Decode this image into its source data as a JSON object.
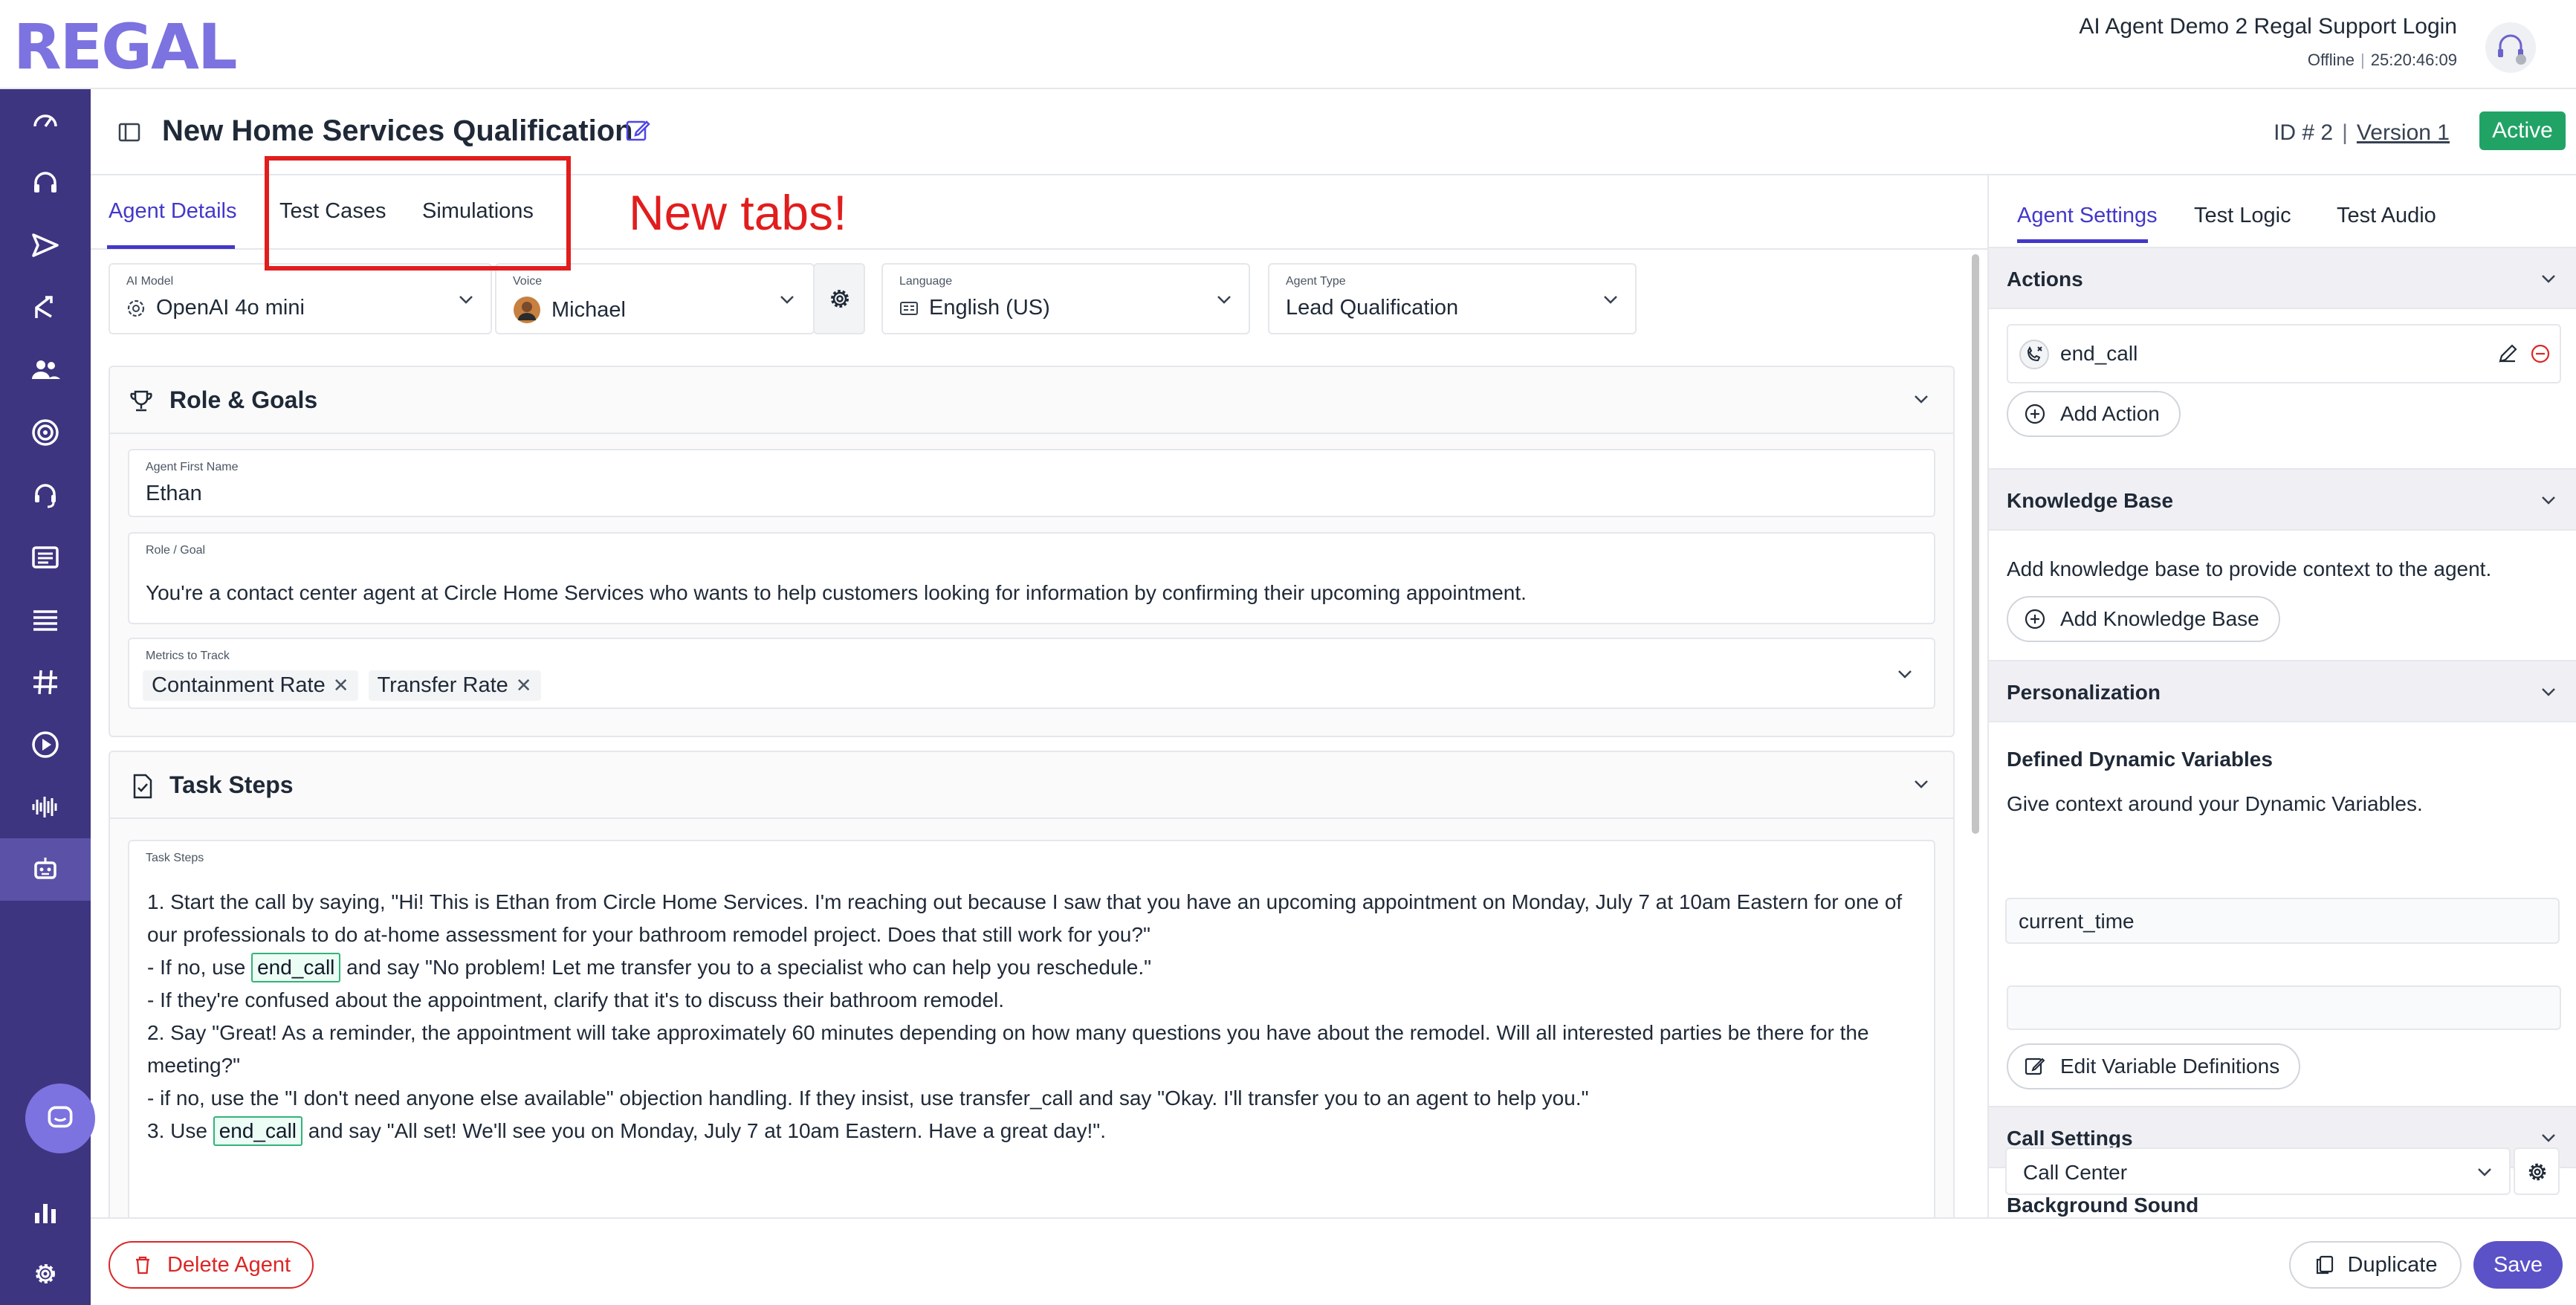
{
  "brand": {
    "logo": "REGAL",
    "accent_color": "#3d3580",
    "active_color": "#21a366"
  },
  "user": {
    "name": "AI Agent Demo 2 Regal Support Login",
    "status": "Offline",
    "timer": "25:20:46:09"
  },
  "sidebar": {
    "items": [
      {
        "icon": "speedometer-icon"
      },
      {
        "icon": "headset-icon"
      },
      {
        "icon": "send-icon"
      },
      {
        "icon": "branch-icon"
      },
      {
        "icon": "users-icon"
      },
      {
        "icon": "target-icon"
      },
      {
        "icon": "support-agent-icon"
      },
      {
        "icon": "contact-card-icon"
      },
      {
        "icon": "list-icon"
      },
      {
        "icon": "hashtag-icon"
      },
      {
        "icon": "play-circle-icon"
      },
      {
        "icon": "waveform-icon"
      },
      {
        "icon": "robot-icon",
        "active": true
      }
    ],
    "bottom": [
      {
        "icon": "bar-chart-icon"
      },
      {
        "icon": "gear-icon"
      }
    ]
  },
  "header": {
    "title": "New Home Services Qualification",
    "id": "ID # 2",
    "version": "Version 1",
    "status": "Active"
  },
  "tabs": [
    {
      "label": "Agent Details",
      "selected": true
    },
    {
      "label": "Test Cases"
    },
    {
      "label": "Simulations"
    }
  ],
  "annotation": {
    "text": "New tabs!"
  },
  "config": {
    "model": {
      "label": "AI Model",
      "value": "OpenAI 4o mini"
    },
    "voice": {
      "label": "Voice",
      "value": "Michael"
    },
    "language": {
      "label": "Language",
      "value": "English (US)"
    },
    "agent_type": {
      "label": "Agent Type",
      "value": "Lead Qualification"
    }
  },
  "role_goals": {
    "title": "Role & Goals",
    "first_name": {
      "label": "Agent First Name",
      "value": "Ethan"
    },
    "role": {
      "label": "Role / Goal",
      "value": "You're a contact center agent at Circle Home Services who wants to help customers looking for information by confirming their upcoming appointment."
    },
    "metrics": {
      "label": "Metrics to Track",
      "chips": [
        "Containment Rate",
        "Transfer Rate"
      ]
    }
  },
  "task_steps": {
    "title": "Task Steps",
    "label": "Task Steps",
    "line1": "1.  Start the call by saying, \"Hi! This is Ethan from Circle Home Services. I'm reaching out because I saw that you have an upcoming appointment on Monday, July 7 at 10am Eastern for one of our professionals to do at-home assessment for your bathroom remodel project. Does that still work for you?\"",
    "line2_pre": "- If no, use ",
    "line2_tag": "end_call",
    "line2_post": " and say \"No problem! Let me transfer you to a specialist who can help you reschedule.\"",
    "line3": "- If they're confused about the appointment, clarify that it's to discuss their bathroom remodel.",
    "line4": "2. Say \"Great! As a reminder, the appointment will take approximately 60 minutes depending on how many questions you have about the remodel. Will all interested parties be there for the meeting?\"",
    "line5": "- if no, use the \"I don't need anyone else available\" objection handling. If they insist, use transfer_call and say \"Okay. I'll transfer you to an agent to help you.\"",
    "line6_pre": "3. Use ",
    "line6_tag": "end_call",
    "line6_post": " and say \"All set! We'll see you on Monday, July 7 at 10am Eastern. Have a great day!\"."
  },
  "right_panel": {
    "tabs": [
      {
        "label": "Agent Settings",
        "selected": true
      },
      {
        "label": "Test Logic"
      },
      {
        "label": "Test Audio"
      }
    ],
    "actions": {
      "title": "Actions",
      "item": "end_call",
      "add_label": "Add Action"
    },
    "knowledge": {
      "title": "Knowledge Base",
      "desc": "Add knowledge base to provide context to the agent.",
      "add_label": "Add Knowledge Base"
    },
    "personalization": {
      "title": "Personalization",
      "subtitle": "Defined Dynamic Variables",
      "desc": "Give context around your Dynamic Variables.",
      "variable": "current_time",
      "edit_label": "Edit Variable Definitions"
    },
    "call_settings": {
      "title": "Call Settings",
      "bg_label": "Background Sound",
      "bg_value": "Call Center"
    }
  },
  "footer": {
    "delete_label": "Delete Agent",
    "duplicate_label": "Duplicate",
    "save_label": "Save"
  }
}
